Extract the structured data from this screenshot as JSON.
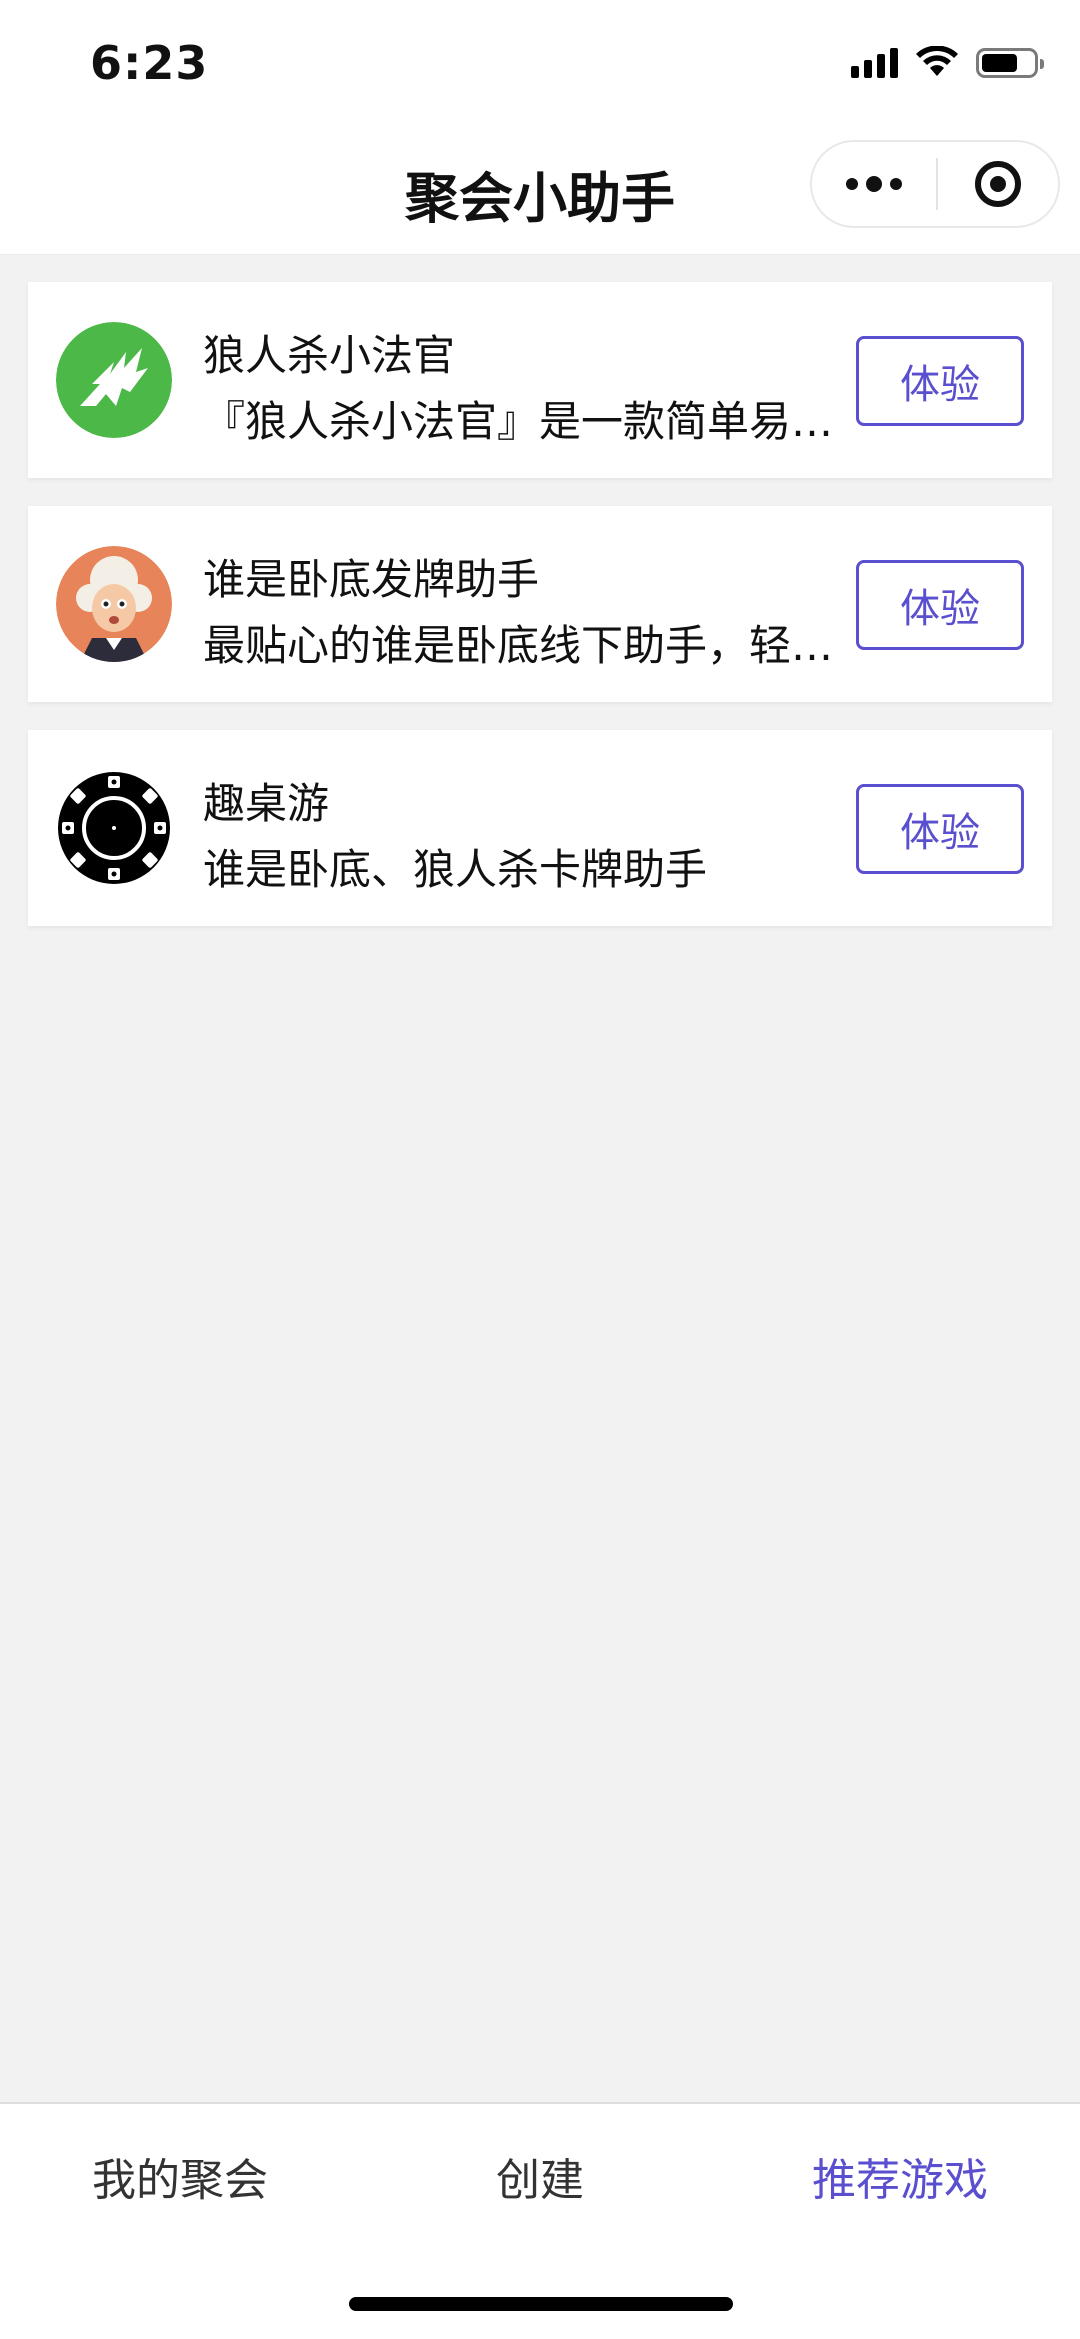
{
  "status_bar": {
    "time": "6:23",
    "icons": [
      "signal-icon",
      "wifi-icon",
      "battery-icon"
    ],
    "battery_level": 0.7
  },
  "nav": {
    "title": "聚会小助手",
    "icons": [
      "more-icon",
      "close-target-icon"
    ]
  },
  "games": [
    {
      "name": "狼人杀小法官",
      "description": "『狼人杀小法官』是一款简单易用的狼人杀游戏辅助工具",
      "button_label": "体验",
      "icon": "werewolf-logo-icon",
      "icon_color": "#4cb848"
    },
    {
      "name": "谁是卧底发牌助手",
      "description": "最贴心的谁是卧底线下助手，轻松发牌一键开局",
      "button_label": "体验",
      "icon": "judge-avatar-icon",
      "icon_color": "#e8845a"
    },
    {
      "name": "趣桌游",
      "description": "谁是卧底、狼人杀卡牌助手",
      "button_label": "体验",
      "icon": "poker-chip-icon",
      "icon_color": "#000000"
    }
  ],
  "tabs": [
    {
      "label": "我的聚会",
      "active": false
    },
    {
      "label": "创建",
      "active": false
    },
    {
      "label": "推荐游戏",
      "active": true
    }
  ],
  "colors": {
    "accent": "#5a4fcf",
    "background": "#f2f2f2",
    "card": "#ffffff"
  }
}
